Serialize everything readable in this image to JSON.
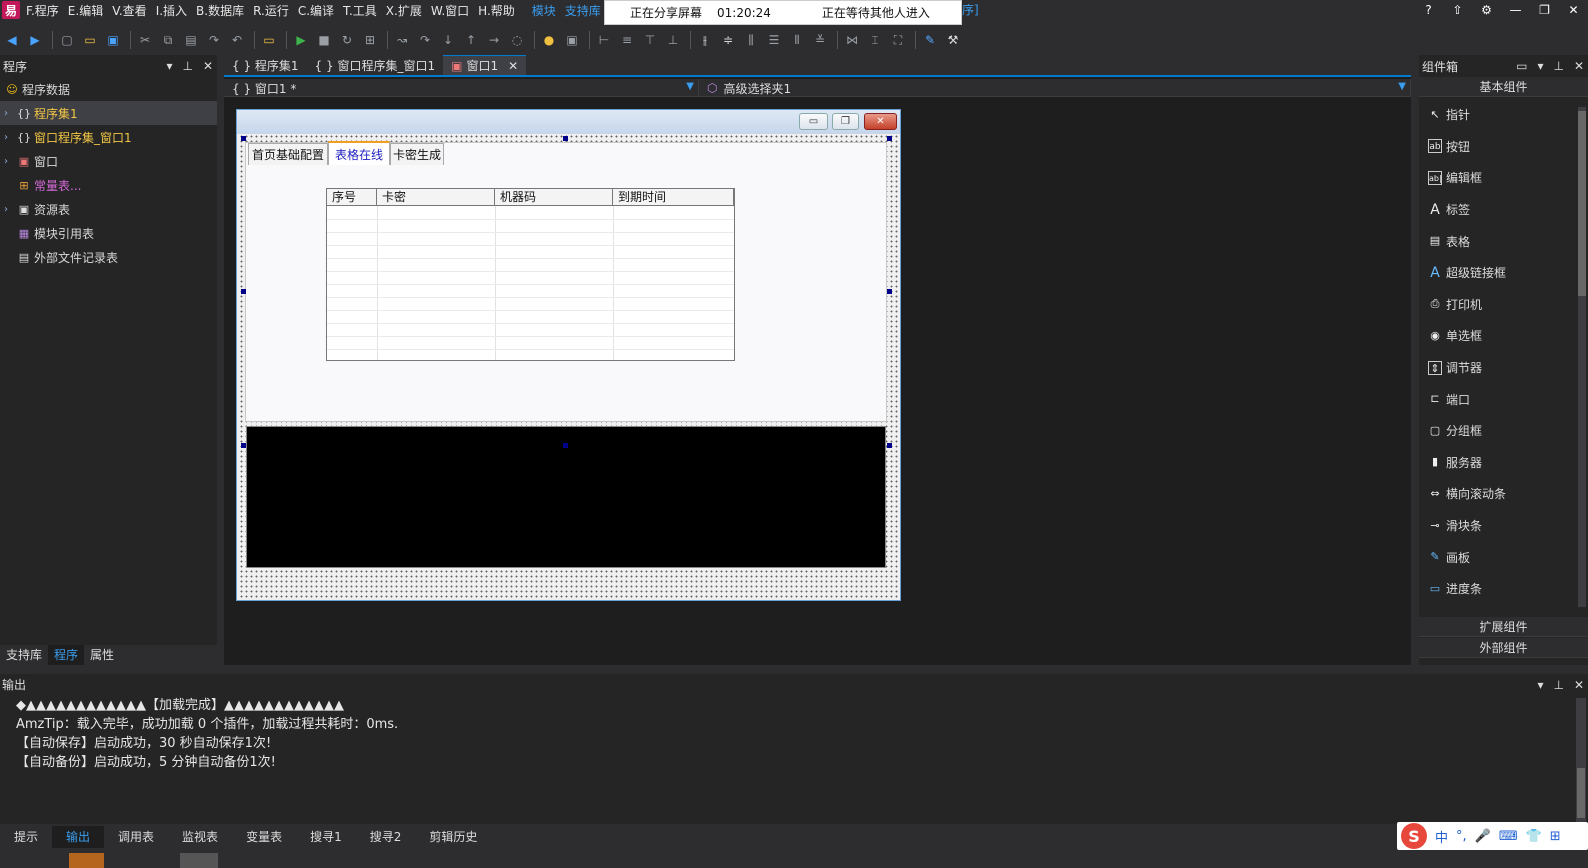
{
  "menubar": {
    "logo": "易",
    "items": [
      "F.程序",
      "E.编辑",
      "V.查看",
      "I.插入",
      "B.数据库",
      "R.运行",
      "C.编译",
      "T.工具",
      "X.扩展",
      "W.窗口",
      "H.帮助"
    ],
    "links": [
      "模块",
      "支持库"
    ],
    "tail": "序]",
    "window_buttons": [
      "?",
      "⇧",
      "⚙",
      "—",
      "❐",
      "✕"
    ]
  },
  "share": {
    "status": "正在分享屏幕",
    "time": "01:20:24",
    "waiting": "正在等待其他人进入"
  },
  "left": {
    "title": "程序",
    "ctrls": [
      "▾",
      "⊥",
      "✕"
    ],
    "root": "程序数据",
    "items": [
      {
        "label": "程序集1",
        "icon": "{}"
      },
      {
        "label": "窗口程序集_窗口1",
        "icon": "{}"
      },
      {
        "label": "窗口",
        "icon": "▣"
      },
      {
        "label": "常量表...",
        "icon": "⊞"
      },
      {
        "label": "资源表",
        "icon": "▣"
      },
      {
        "label": "模块引用表",
        "icon": "▦"
      },
      {
        "label": "外部文件记录表",
        "icon": "▤"
      }
    ],
    "tabs": [
      "支持库",
      "程序",
      "属性"
    ]
  },
  "editor": {
    "tabs": [
      {
        "label": "{ } 程序集1"
      },
      {
        "label": "{ } 窗口程序集_窗口1"
      },
      {
        "label": "窗口1"
      }
    ],
    "close": "✕",
    "sub_left": "{ } 窗口1 *",
    "sub_right": "高级选择夹1"
  },
  "design": {
    "tabs": [
      "首页基础配置",
      "表格在线",
      "卡密生成"
    ],
    "columns": [
      "序号",
      "卡密",
      "机器码",
      "到期时间"
    ],
    "win_buttons": [
      "▭",
      "❐",
      "✕"
    ]
  },
  "right": {
    "title": "组件箱",
    "ctrls": [
      "▭",
      "▾",
      "⊥",
      "✕"
    ],
    "section_basic": "基本组件",
    "components": [
      {
        "label": "指针",
        "icon": "↖"
      },
      {
        "label": "按钮",
        "icon": "ab"
      },
      {
        "label": "编辑框",
        "icon": "ab|"
      },
      {
        "label": "标签",
        "icon": "A"
      },
      {
        "label": "表格",
        "icon": "▤"
      },
      {
        "label": "超级链接框",
        "icon": "A"
      },
      {
        "label": "打印机",
        "icon": "⎙"
      },
      {
        "label": "单选框",
        "icon": "◉"
      },
      {
        "label": "调节器",
        "icon": "⇕"
      },
      {
        "label": "端口",
        "icon": "⊏"
      },
      {
        "label": "分组框",
        "icon": "▢"
      },
      {
        "label": "服务器",
        "icon": "▮"
      },
      {
        "label": "横向滚动条",
        "icon": "⇔"
      },
      {
        "label": "滑块条",
        "icon": "⊸"
      },
      {
        "label": "画板",
        "icon": "✎"
      },
      {
        "label": "进度条",
        "icon": "▭"
      }
    ],
    "section_ext": "扩展组件",
    "section_external": "外部组件"
  },
  "output": {
    "title": "输出",
    "ctrls": [
      "▾",
      "⊥",
      "✕"
    ],
    "lines": [
      "◆▲▲▲▲▲▲▲▲▲▲▲▲【加载完成】▲▲▲▲▲▲▲▲▲▲▲▲",
      "AmzTip：载入完毕，成功加载 0 个插件，加载过程共耗时：0ms.",
      "【自动保存】启动成功，30 秒自动保存1次!",
      "【自动备份】启动成功，5 分钟自动备份1次!"
    ]
  },
  "bottom_tabs": [
    "提示",
    "输出",
    "调用表",
    "监视表",
    "变量表",
    "搜寻1",
    "搜寻2",
    "剪辑历史"
  ],
  "ime": {
    "logo": "S",
    "items": [
      "中",
      "°,",
      "🎤",
      "⌨",
      "👕",
      "⊞"
    ]
  }
}
